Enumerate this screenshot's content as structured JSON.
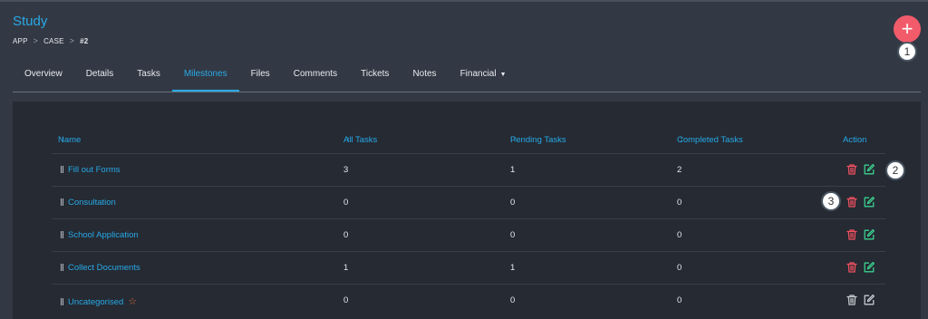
{
  "header": {
    "title": "Study",
    "breadcrumb": [
      "APP",
      "CASE",
      "#2"
    ],
    "breadcrumb_separator": ">",
    "add_label": "+"
  },
  "callouts": [
    "1",
    "2",
    "3"
  ],
  "tabs": [
    {
      "label": "Overview"
    },
    {
      "label": "Details"
    },
    {
      "label": "Tasks"
    },
    {
      "label": "Milestones",
      "active": true
    },
    {
      "label": "Files"
    },
    {
      "label": "Comments"
    },
    {
      "label": "Tickets"
    },
    {
      "label": "Notes"
    },
    {
      "label": "Financial",
      "dropdown": true
    }
  ],
  "table": {
    "columns": [
      "Name",
      "All Tasks",
      "Pending Tasks",
      "Completed Tasks",
      "Action"
    ],
    "sort_glyph": "↕",
    "rows": [
      {
        "name": "Fill out Forms",
        "all": "3",
        "pending": "1",
        "completed": "2"
      },
      {
        "name": "Consultation",
        "all": "0",
        "pending": "0",
        "completed": "0"
      },
      {
        "name": "School Application",
        "all": "0",
        "pending": "0",
        "completed": "0"
      },
      {
        "name": "Collect Documents",
        "all": "1",
        "pending": "1",
        "completed": "0"
      },
      {
        "name": "Uncategorised",
        "all": "0",
        "pending": "0",
        "completed": "0",
        "starred": true,
        "muted_actions": true
      }
    ]
  },
  "icons": {
    "delete": "trash-icon",
    "edit": "edit-icon",
    "star": "star-icon",
    "drag": "drag-handle-icon",
    "caret": "caret-down-icon"
  },
  "colors": {
    "accent": "#28a9e6",
    "delete": "#f0505f",
    "edit": "#3ccf8e",
    "muted": "#c3c8cf",
    "add_button": "#f25b6a",
    "star": "#e06a3a"
  }
}
